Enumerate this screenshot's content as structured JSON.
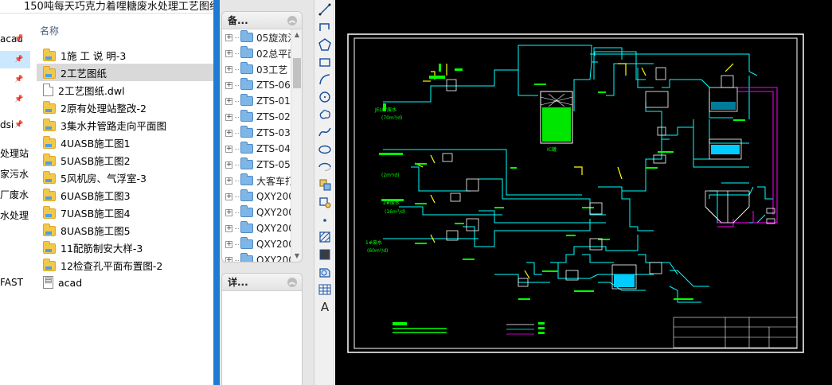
{
  "window": {
    "title": "150吨每天巧克力着哩糖废水处理工艺图纸"
  },
  "quick_access": {
    "items": [
      {
        "label": "acad",
        "pinned": true,
        "selected": false
      },
      {
        "label": "",
        "pinned": true,
        "selected": true
      },
      {
        "label": "",
        "pinned": true,
        "selected": false
      },
      {
        "label": "",
        "pinned": true,
        "selected": false
      },
      {
        "label": "dsi",
        "pinned": true,
        "selected": false
      },
      {
        "label": "处理站",
        "pinned": false,
        "selected": false
      },
      {
        "label": "家污水",
        "pinned": false,
        "selected": false
      },
      {
        "label": "厂废水",
        "pinned": false,
        "selected": false
      },
      {
        "label": "水处理",
        "pinned": false,
        "selected": false
      },
      {
        "label": "FAST",
        "pinned": false,
        "selected": false
      }
    ]
  },
  "file_pane": {
    "column_header": "名称",
    "files": [
      {
        "name": "1施 工 说 明-3",
        "type": "folder",
        "selected": false
      },
      {
        "name": "2工艺图纸",
        "type": "folder",
        "selected": true
      },
      {
        "name": "2工艺图纸.dwl",
        "type": "file",
        "selected": false
      },
      {
        "name": "2原有处理站整改-2",
        "type": "folder",
        "selected": false
      },
      {
        "name": "3集水井管路走向平面图",
        "type": "folder",
        "selected": false
      },
      {
        "name": "4UASB施工图1",
        "type": "folder",
        "selected": false
      },
      {
        "name": "5UASB施工图2",
        "type": "folder",
        "selected": false
      },
      {
        "name": "5风机房、气浮室-3",
        "type": "folder",
        "selected": false
      },
      {
        "name": "6UASB施工图3",
        "type": "folder",
        "selected": false
      },
      {
        "name": "7UASB施工图4",
        "type": "folder",
        "selected": false
      },
      {
        "name": "8UASB施工图5",
        "type": "folder",
        "selected": false
      },
      {
        "name": "11配筋制安大样-3",
        "type": "folder",
        "selected": false
      },
      {
        "name": "12检查孔平面布置图-2",
        "type": "folder",
        "selected": false
      },
      {
        "name": "acad",
        "type": "acad",
        "selected": false
      }
    ]
  },
  "tree_panel": {
    "header": "备...",
    "items": [
      "05旋流沉",
      "02总平面",
      "03工艺",
      "ZTS-06",
      "ZTS-01",
      "ZTS-02",
      "ZTS-03",
      "ZTS-04",
      "ZTS-05",
      "大客车打",
      "QXY200",
      "QXY200",
      "QXY200",
      "QXY200",
      "QXY200"
    ]
  },
  "details_panel": {
    "header": "详..."
  },
  "toolbar": {
    "tools": [
      {
        "icon": "line-tool-icon"
      },
      {
        "icon": "polyline-tool-icon"
      },
      {
        "icon": "polygon-tool-icon"
      },
      {
        "icon": "rectangle-tool-icon"
      },
      {
        "icon": "arc-tool-icon"
      },
      {
        "icon": "circle-tool-icon"
      },
      {
        "icon": "revcloud-tool-icon"
      },
      {
        "icon": "spline-tool-icon"
      },
      {
        "icon": "ellipse-tool-icon"
      },
      {
        "icon": "ellipse-arc-tool-icon"
      },
      {
        "icon": "insert-block-tool-icon"
      },
      {
        "icon": "make-block-tool-icon"
      },
      {
        "icon": "point-tool-icon"
      },
      {
        "icon": "hatch-tool-icon"
      },
      {
        "icon": "gradient-tool-icon"
      },
      {
        "icon": "region-tool-icon"
      },
      {
        "icon": "table-tool-icon"
      },
      {
        "icon": "text-tool-icon",
        "label": "A"
      }
    ]
  },
  "drawing": {
    "labels": {
      "jelly": "JELLY废水",
      "jelly_flow": "(70m³/d)",
      "ic_tank": "IC罐",
      "waste2_flow": "(2m³/d)",
      "waste3": "2#废水",
      "waste3_flow": "(16m³/d)",
      "waste4": "1#废水",
      "waste4_flow": "(60m³/d)"
    },
    "colors": {
      "frame": "#ffffff",
      "pipe": "#00ffff",
      "equipment": "#ffffff",
      "green_fill": "#00ff00",
      "yellow": "#ffff00",
      "magenta": "#ff00ff",
      "blue_fill": "#00aaff"
    }
  }
}
